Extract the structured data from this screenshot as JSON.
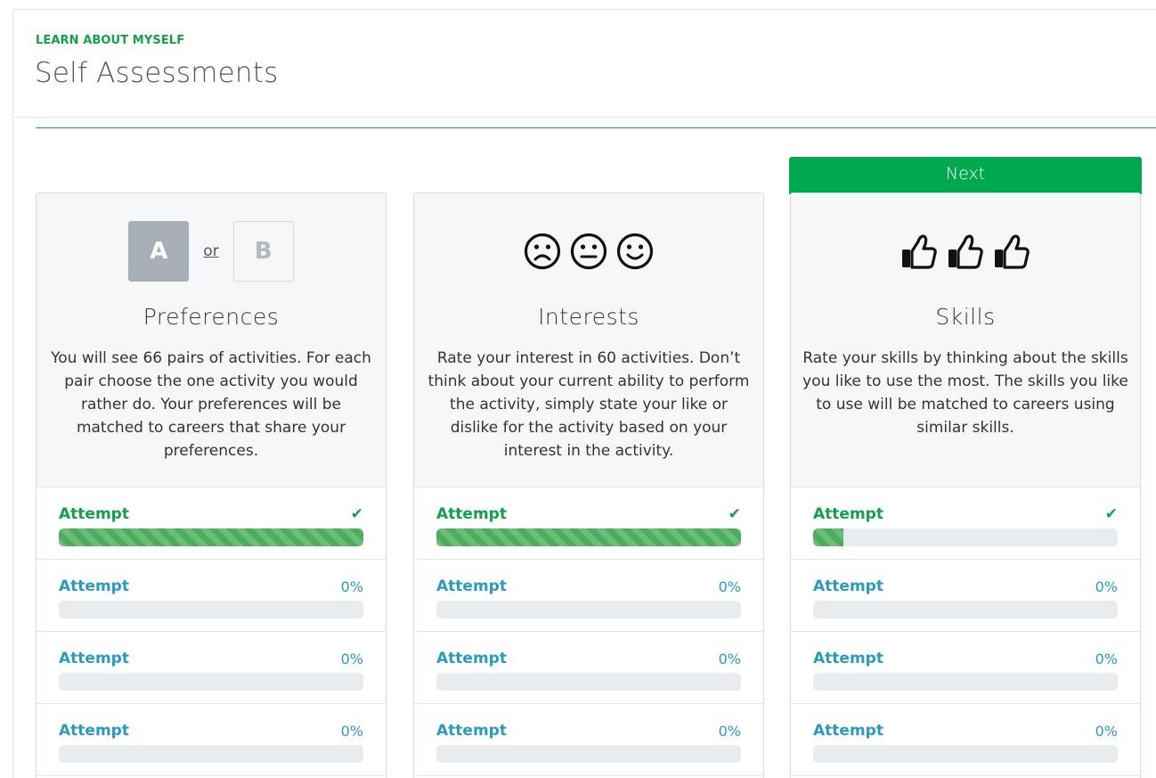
{
  "header": {
    "eyebrow": "LEARN ABOUT MYSELF",
    "title": "Self Assessments"
  },
  "next_banner": "Next",
  "colors": {
    "brand_green": "#00a94f",
    "label_green": "#13a04a",
    "link_blue": "#2a9bbf",
    "bar_track": "#e9ecef"
  },
  "cards": [
    {
      "id": "preferences",
      "icon": "ab-choice-icon",
      "ab": {
        "a": "A",
        "or": "or",
        "b": "B"
      },
      "title": "Preferences",
      "description": "You will see 66 pairs of activities. For each pair choose the one activity you would rather do. Your preferences will be matched to careers that share your preferences.",
      "attempts": [
        {
          "label": "Attempt",
          "status": "complete",
          "progress": 1.0
        },
        {
          "label": "Attempt",
          "status": "pending",
          "progress_text": "0%",
          "progress": 0
        },
        {
          "label": "Attempt",
          "status": "pending",
          "progress_text": "0%",
          "progress": 0
        },
        {
          "label": "Attempt",
          "status": "pending",
          "progress_text": "0%",
          "progress": 0
        }
      ]
    },
    {
      "id": "interests",
      "icon": "face-rating-icons",
      "title": "Interests",
      "description": "Rate your interest in 60 activities. Don’t think about your current ability to perform the activity, simply state your like or dislike for the activity based on your interest in the activity.",
      "attempts": [
        {
          "label": "Attempt",
          "status": "complete",
          "progress": 1.0
        },
        {
          "label": "Attempt",
          "status": "pending",
          "progress_text": "0%",
          "progress": 0
        },
        {
          "label": "Attempt",
          "status": "pending",
          "progress_text": "0%",
          "progress": 0
        },
        {
          "label": "Attempt",
          "status": "pending",
          "progress_text": "0%",
          "progress": 0
        }
      ]
    },
    {
      "id": "skills",
      "icon": "thumbs-up-icons",
      "title": "Skills",
      "description": "Rate your skills by thinking about the skills you like to use the most. The skills you like to use will be matched to careers using similar skills.",
      "attempts": [
        {
          "label": "Attempt",
          "status": "complete",
          "progress": 0.1
        },
        {
          "label": "Attempt",
          "status": "pending",
          "progress_text": "0%",
          "progress": 0
        },
        {
          "label": "Attempt",
          "status": "pending",
          "progress_text": "0%",
          "progress": 0
        },
        {
          "label": "Attempt",
          "status": "pending",
          "progress_text": "0%",
          "progress": 0
        }
      ]
    }
  ]
}
